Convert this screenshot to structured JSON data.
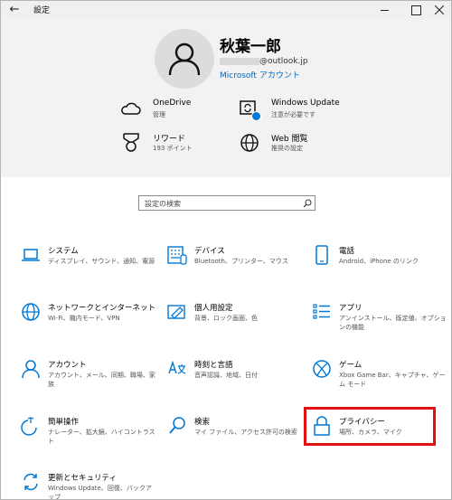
{
  "window": {
    "title": "設定"
  },
  "user": {
    "name": "秋葉一郎",
    "email_suffix": "@outlook.jp",
    "account_link": "Microsoft アカウント"
  },
  "header_items": [
    {
      "title": "OneDrive",
      "sub": "管理",
      "icon": "cloud-icon"
    },
    {
      "title": "Windows Update",
      "sub": "注意が必要です",
      "icon": "windows-update-icon"
    },
    {
      "title": "リワード",
      "sub": "193 ポイント",
      "icon": "medal-icon"
    },
    {
      "title": "Web 閲覧",
      "sub": "推奨の設定",
      "icon": "globe-icon"
    }
  ],
  "search": {
    "placeholder": "設定の検索"
  },
  "categories": [
    {
      "title": "システム",
      "sub": "ディスプレイ、サウンド、通知、電源",
      "icon": "laptop-icon"
    },
    {
      "title": "デバイス",
      "sub": "Bluetooth、プリンター、マウス",
      "icon": "keyboard-icon"
    },
    {
      "title": "電話",
      "sub": "Android、iPhone のリンク",
      "icon": "phone-icon"
    },
    {
      "title": "ネットワークとインターネット",
      "sub": "Wi-Fi、機内モード、VPN",
      "icon": "network-globe-icon"
    },
    {
      "title": "個人用設定",
      "sub": "背景、ロック画面、色",
      "icon": "personalization-icon"
    },
    {
      "title": "アプリ",
      "sub": "アンインストール、既定値、オプションの機能",
      "icon": "apps-list-icon"
    },
    {
      "title": "アカウント",
      "sub": "アカウント、メール、同期、職場、家族",
      "icon": "person-icon"
    },
    {
      "title": "時刻と言語",
      "sub": "音声認識、地域、日付",
      "icon": "time-language-icon"
    },
    {
      "title": "ゲーム",
      "sub": "Xbox Game Bar、キャプチャ、ゲーム モード",
      "icon": "xbox-icon"
    },
    {
      "title": "簡単操作",
      "sub": "ナレーター、拡大鏡、ハイコントラスト",
      "icon": "ease-of-access-icon"
    },
    {
      "title": "検索",
      "sub": "マイ ファイル、アクセス許可の検索",
      "icon": "search-icon"
    },
    {
      "title": "プライバシー",
      "sub": "場所、カメラ、マイク",
      "icon": "lock-icon"
    },
    {
      "title": "更新とセキュリティ",
      "sub": "Windows Update、回復、バックアップ",
      "icon": "update-security-icon"
    }
  ],
  "colors": {
    "accent": "#0078d4",
    "link": "#0067c0",
    "highlight": "#e01010",
    "header_bg": "#f2f2f2"
  }
}
